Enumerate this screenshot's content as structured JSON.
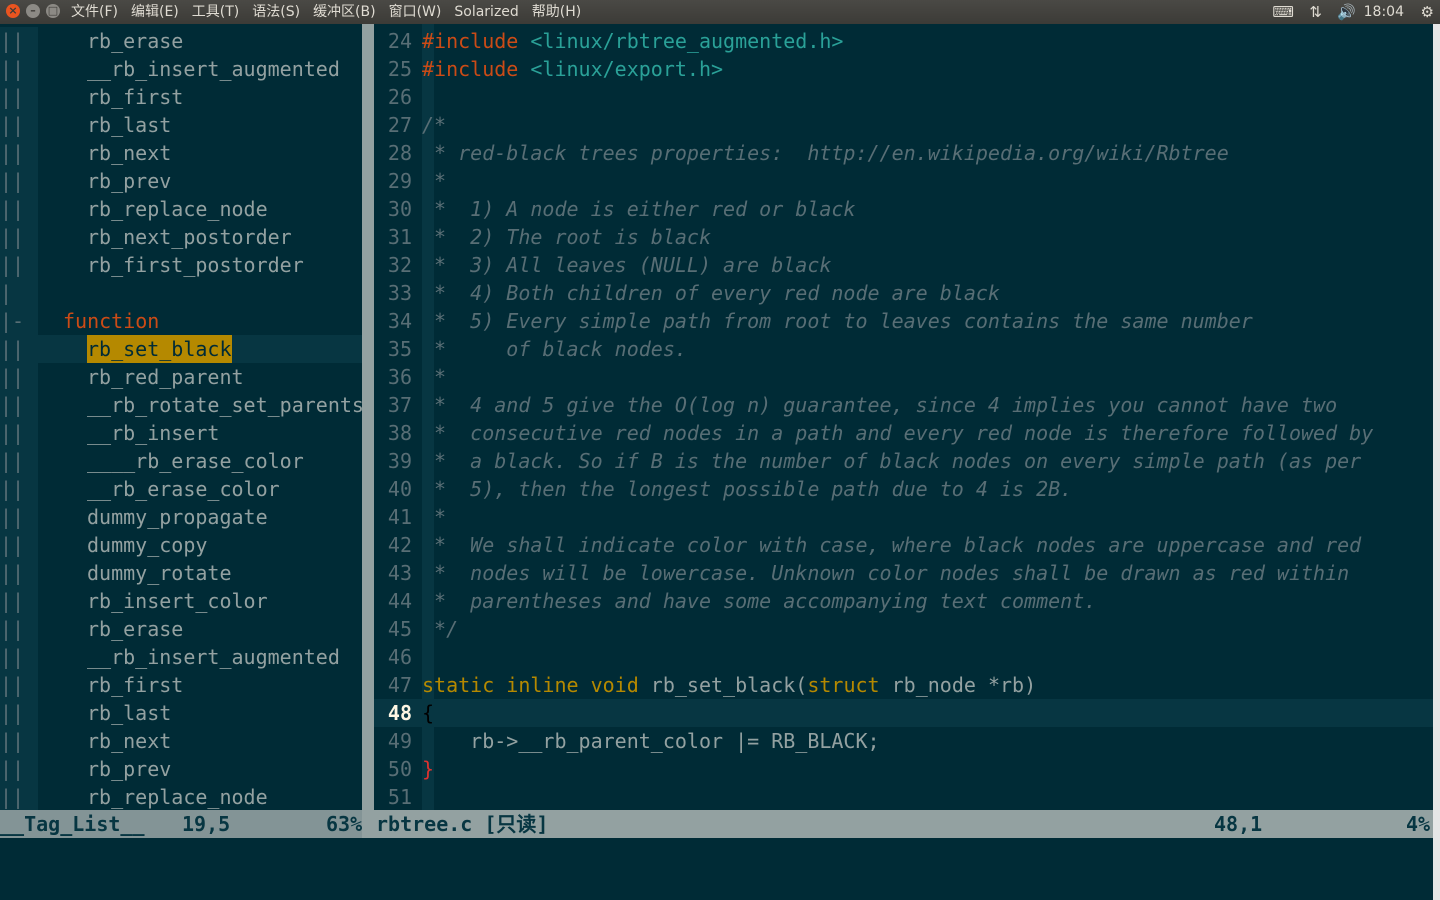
{
  "menubar": {
    "menus": [
      "文件(F)",
      "编辑(E)",
      "工具(T)",
      "语法(S)",
      "缓冲区(B)",
      "窗口(W)",
      "Solarized",
      "帮助(H)"
    ],
    "window_buttons": {
      "close": "×",
      "minimize": "–",
      "maximize": "□"
    },
    "indicators": {
      "keyboard_icon": "⌨",
      "network_icon": "⇅",
      "volume_icon": "🔊",
      "clock": "18:04",
      "settings_icon": "⚙"
    }
  },
  "taglist": {
    "lines": [
      {
        "bar": "||",
        "text": "rb_erase",
        "indent": 3
      },
      {
        "bar": "||",
        "text": "__rb_insert_augmented",
        "indent": 3
      },
      {
        "bar": "||",
        "text": "rb_first",
        "indent": 3
      },
      {
        "bar": "||",
        "text": "rb_last",
        "indent": 3
      },
      {
        "bar": "||",
        "text": "rb_next",
        "indent": 3
      },
      {
        "bar": "||",
        "text": "rb_prev",
        "indent": 3
      },
      {
        "bar": "||",
        "text": "rb_replace_node",
        "indent": 3
      },
      {
        "bar": "||",
        "text": "rb_next_postorder",
        "indent": 3
      },
      {
        "bar": "||",
        "text": "rb_first_postorder",
        "indent": 3
      },
      {
        "bar": "|",
        "text": "",
        "indent": 3
      },
      {
        "bar": "|-",
        "text": "function",
        "indent": 2,
        "kind": true
      },
      {
        "bar": "||",
        "text": "rb_set_black",
        "indent": 3,
        "highlight": true
      },
      {
        "bar": "||",
        "text": "rb_red_parent",
        "indent": 3
      },
      {
        "bar": "||",
        "text": "__rb_rotate_set_parents",
        "indent": 3
      },
      {
        "bar": "||",
        "text": "__rb_insert",
        "indent": 3
      },
      {
        "bar": "||",
        "text": "____rb_erase_color",
        "indent": 3
      },
      {
        "bar": "||",
        "text": "__rb_erase_color",
        "indent": 3
      },
      {
        "bar": "||",
        "text": "dummy_propagate",
        "indent": 3
      },
      {
        "bar": "||",
        "text": "dummy_copy",
        "indent": 3
      },
      {
        "bar": "||",
        "text": "dummy_rotate",
        "indent": 3
      },
      {
        "bar": "||",
        "text": "rb_insert_color",
        "indent": 3
      },
      {
        "bar": "||",
        "text": "rb_erase",
        "indent": 3
      },
      {
        "bar": "||",
        "text": "__rb_insert_augmented",
        "indent": 3
      },
      {
        "bar": "||",
        "text": "rb_first",
        "indent": 3
      },
      {
        "bar": "||",
        "text": "rb_last",
        "indent": 3
      },
      {
        "bar": "||",
        "text": "rb_next",
        "indent": 3
      },
      {
        "bar": "||",
        "text": "rb_prev",
        "indent": 3
      },
      {
        "bar": "||",
        "text": "rb_replace_node",
        "indent": 3
      }
    ]
  },
  "code": {
    "lines": [
      {
        "num": "24",
        "segs": [
          {
            "t": "#include",
            "c": "pre"
          },
          {
            "t": " ",
            "c": "txt"
          },
          {
            "t": "<linux/rbtree_augmented.h>",
            "c": "str"
          }
        ]
      },
      {
        "num": "25",
        "segs": [
          {
            "t": "#include",
            "c": "pre"
          },
          {
            "t": " ",
            "c": "txt"
          },
          {
            "t": "<linux/export.h>",
            "c": "str"
          }
        ]
      },
      {
        "num": "26",
        "segs": []
      },
      {
        "num": "27",
        "segs": [
          {
            "t": "/*",
            "c": "com"
          }
        ]
      },
      {
        "num": "28",
        "segs": [
          {
            "t": " * red-black trees properties:  http://en.wikipedia.org/wiki/Rbtree",
            "c": "com"
          }
        ]
      },
      {
        "num": "29",
        "segs": [
          {
            "t": " *",
            "c": "com"
          }
        ]
      },
      {
        "num": "30",
        "segs": [
          {
            "t": " *  1) A node is either red or black",
            "c": "com"
          }
        ]
      },
      {
        "num": "31",
        "segs": [
          {
            "t": " *  2) The root is black",
            "c": "com"
          }
        ]
      },
      {
        "num": "32",
        "segs": [
          {
            "t": " *  3) All leaves (NULL) are black",
            "c": "com"
          }
        ]
      },
      {
        "num": "33",
        "segs": [
          {
            "t": " *  4) Both children of every red node are black",
            "c": "com"
          }
        ]
      },
      {
        "num": "34",
        "segs": [
          {
            "t": " *  5) Every simple path from root to leaves contains the same number",
            "c": "com"
          }
        ]
      },
      {
        "num": "35",
        "segs": [
          {
            "t": " *     of black nodes.",
            "c": "com"
          }
        ]
      },
      {
        "num": "36",
        "segs": [
          {
            "t": " *",
            "c": "com"
          }
        ]
      },
      {
        "num": "37",
        "segs": [
          {
            "t": " *  4 and 5 give the O(log n) guarantee, since 4 implies you cannot have two",
            "c": "com"
          }
        ]
      },
      {
        "num": "38",
        "segs": [
          {
            "t": " *  consecutive red nodes in a path and every red node is therefore followed by",
            "c": "com"
          }
        ]
      },
      {
        "num": "39",
        "segs": [
          {
            "t": " *  a black. So if B is the number of black nodes on every simple path (as per",
            "c": "com"
          }
        ]
      },
      {
        "num": "40",
        "segs": [
          {
            "t": " *  5), then the longest possible path due to 4 is 2B.",
            "c": "com"
          }
        ]
      },
      {
        "num": "41",
        "segs": [
          {
            "t": " *",
            "c": "com"
          }
        ]
      },
      {
        "num": "42",
        "segs": [
          {
            "t": " *  We shall indicate color with case, where black nodes are uppercase and red",
            "c": "com"
          }
        ]
      },
      {
        "num": "43",
        "segs": [
          {
            "t": " *  nodes will be lowercase. Unknown color nodes shall be drawn as red within",
            "c": "com"
          }
        ]
      },
      {
        "num": "44",
        "segs": [
          {
            "t": " *  parentheses and have some accompanying text comment.",
            "c": "com"
          }
        ]
      },
      {
        "num": "45",
        "segs": [
          {
            "t": " */",
            "c": "com"
          }
        ]
      },
      {
        "num": "46",
        "segs": []
      },
      {
        "num": "47",
        "segs": [
          {
            "t": "static",
            "c": "kw"
          },
          {
            "t": " ",
            "c": "txt"
          },
          {
            "t": "inline",
            "c": "kw"
          },
          {
            "t": " ",
            "c": "txt"
          },
          {
            "t": "void",
            "c": "kw"
          },
          {
            "t": " rb_set_black(",
            "c": "txt"
          },
          {
            "t": "struct",
            "c": "kw"
          },
          {
            "t": " rb_node *rb)",
            "c": "txt"
          }
        ]
      },
      {
        "num": "48",
        "current": true,
        "segs": [
          {
            "t": "{",
            "c": "cursor"
          }
        ]
      },
      {
        "num": "49",
        "segs": [
          {
            "t": "    rb->__rb_parent_color |= RB_BLACK;",
            "c": "txt"
          }
        ]
      },
      {
        "num": "50",
        "segs": [
          {
            "t": "}",
            "c": "brace"
          }
        ]
      },
      {
        "num": "51",
        "segs": []
      }
    ]
  },
  "status": {
    "taglist_name": "__Tag_List__",
    "taglist_pos": "19,5",
    "taglist_pct": "63%",
    "file": "rbtree.c [只读]",
    "pos": "48,1",
    "pct": "4%"
  },
  "colors": {
    "background": "#002b36",
    "base02": "#073642",
    "base1": "#93a1a1",
    "base01": "#586e75",
    "orange": "#cb4b16",
    "cyan": "#2aa198",
    "yellow": "#b58900",
    "red": "#dc322f"
  }
}
